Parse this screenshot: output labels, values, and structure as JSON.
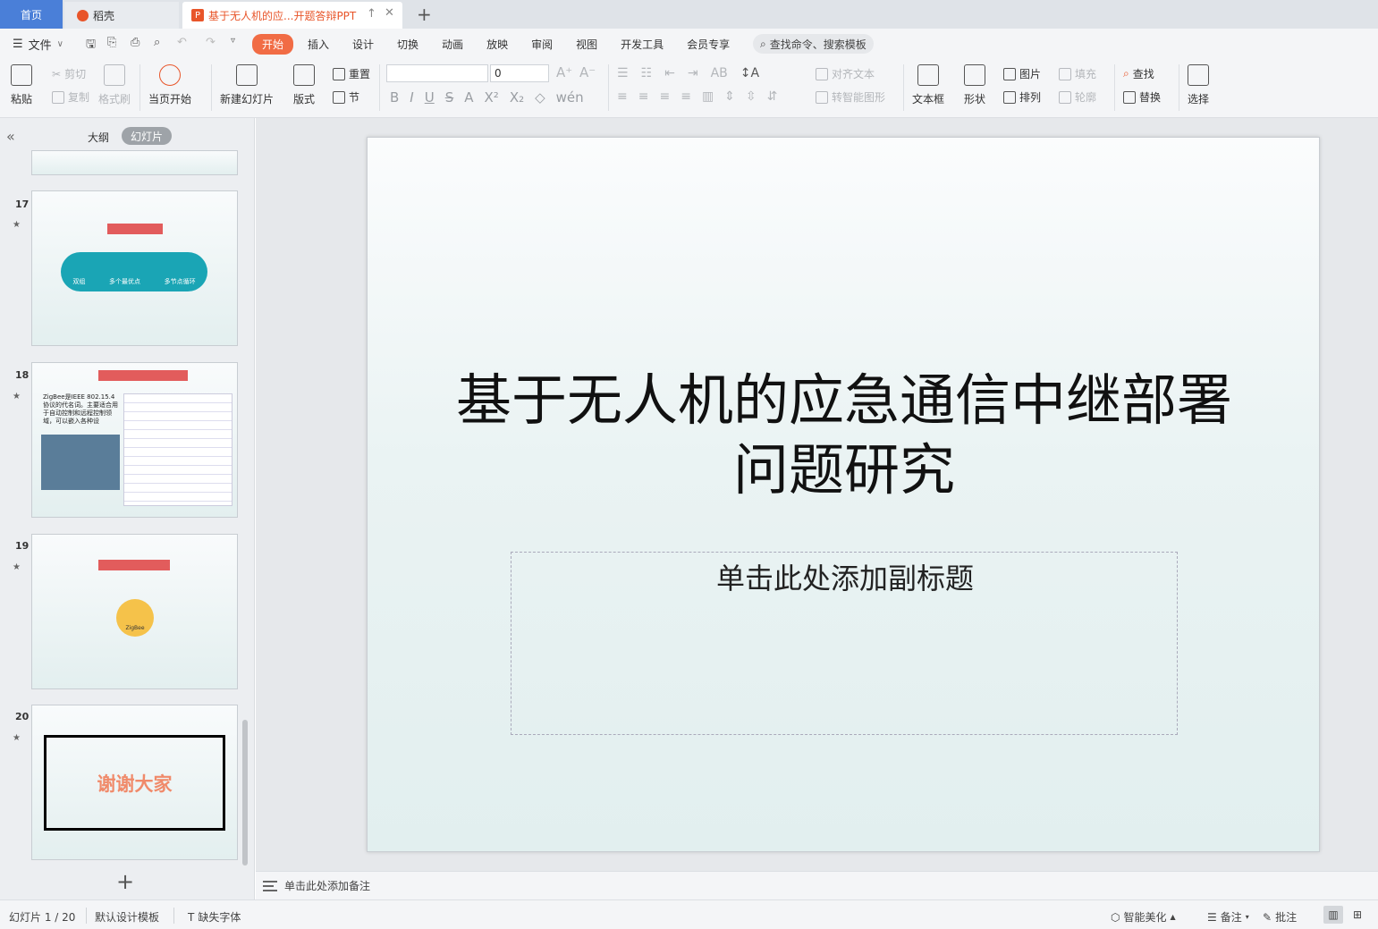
{
  "tabs": {
    "home": "首页",
    "daoke": "稻壳",
    "doc": "基于无人机的应...开题答辩PPT"
  },
  "menu": {
    "file": "文件",
    "tabs": [
      "开始",
      "插入",
      "设计",
      "切换",
      "动画",
      "放映",
      "审阅",
      "视图",
      "开发工具",
      "会员专享"
    ],
    "search": "查找命令、搜索模板"
  },
  "toolbar": {
    "paste": "粘贴",
    "cut": "剪切",
    "copy": "复制",
    "format_painter": "格式刷",
    "from_current": "当页开始",
    "new_slide": "新建幻灯片",
    "layout": "版式",
    "reset": "重置",
    "section": "节",
    "font_size": "0",
    "align_text": "对齐文本",
    "smartart": "转智能图形",
    "textbox": "文本框",
    "shape": "形状",
    "picture": "图片",
    "fill": "填充",
    "arrange": "排列",
    "outline": "轮廓",
    "find": "查找",
    "replace": "替换",
    "select": "选择"
  },
  "left_panel": {
    "outline": "大纲",
    "slides": "幻灯片",
    "thumbs": [
      {
        "num": "17",
        "labels": [
          "双组",
          "多个最优点",
          "多节点循环"
        ]
      },
      {
        "num": "18",
        "text": "ZigBee是IEEE 802.15.4协议的代名词。主要适合用于自动控制和远程控制领域，可以嵌入各种设"
      },
      {
        "num": "19",
        "center": "ZigBee"
      },
      {
        "num": "20",
        "text": "谢谢大家"
      }
    ]
  },
  "slide": {
    "title": "基于无人机的应急通信中继部署问题研究",
    "subtitle": "单击此处添加副标题"
  },
  "notes": "单击此处添加备注",
  "status": {
    "slide_info": "幻灯片 1 / 20",
    "template": "默认设计模板",
    "missing_font": "缺失字体",
    "beautify": "智能美化",
    "notes": "备注",
    "comments": "批注"
  }
}
